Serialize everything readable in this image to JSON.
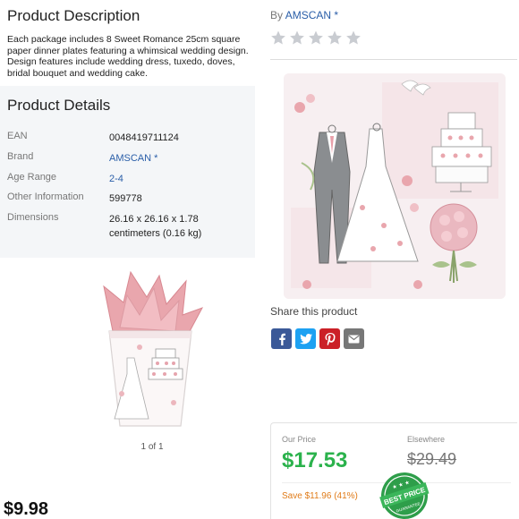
{
  "description": {
    "title": "Product Description",
    "body": "Each package includes 8 Sweet Romance 25cm square paper dinner plates featuring a whimsical wedding design. Design features include wedding dress, tuxedo, doves, bridal bouquet and wedding cake."
  },
  "details": {
    "title": "Product Details",
    "rows": [
      {
        "label": "EAN",
        "value": "0048419711124"
      },
      {
        "label": "Brand",
        "value": "AMSCAN *"
      },
      {
        "label": "Age Range",
        "value": "2-4"
      },
      {
        "label": "Other Information",
        "value": "599778"
      },
      {
        "label": "Dimensions",
        "value": "26.16 x 26.16 x 1.78 centimeters (0.16 kg)"
      }
    ]
  },
  "gallery": {
    "pager": "1 of 1"
  },
  "left_price": "$9.98",
  "byline": {
    "prefix": "By ",
    "brand": "AMSCAN *"
  },
  "rating": {
    "stars": 5,
    "filled": 0
  },
  "share": {
    "label": "Share this product"
  },
  "pricing": {
    "our_label": "Our Price",
    "our_price": "$17.53",
    "else_label": "Elsewhere",
    "else_price": "$29.49",
    "save": "Save $11.96 (41%)",
    "badge_top": "BEST PRICE",
    "badge_bottom": "GUARANTEE"
  },
  "colors": {
    "brand_link": "#2a5ea8",
    "price_green": "#2bb24c",
    "save_orange": "#e07b18"
  }
}
